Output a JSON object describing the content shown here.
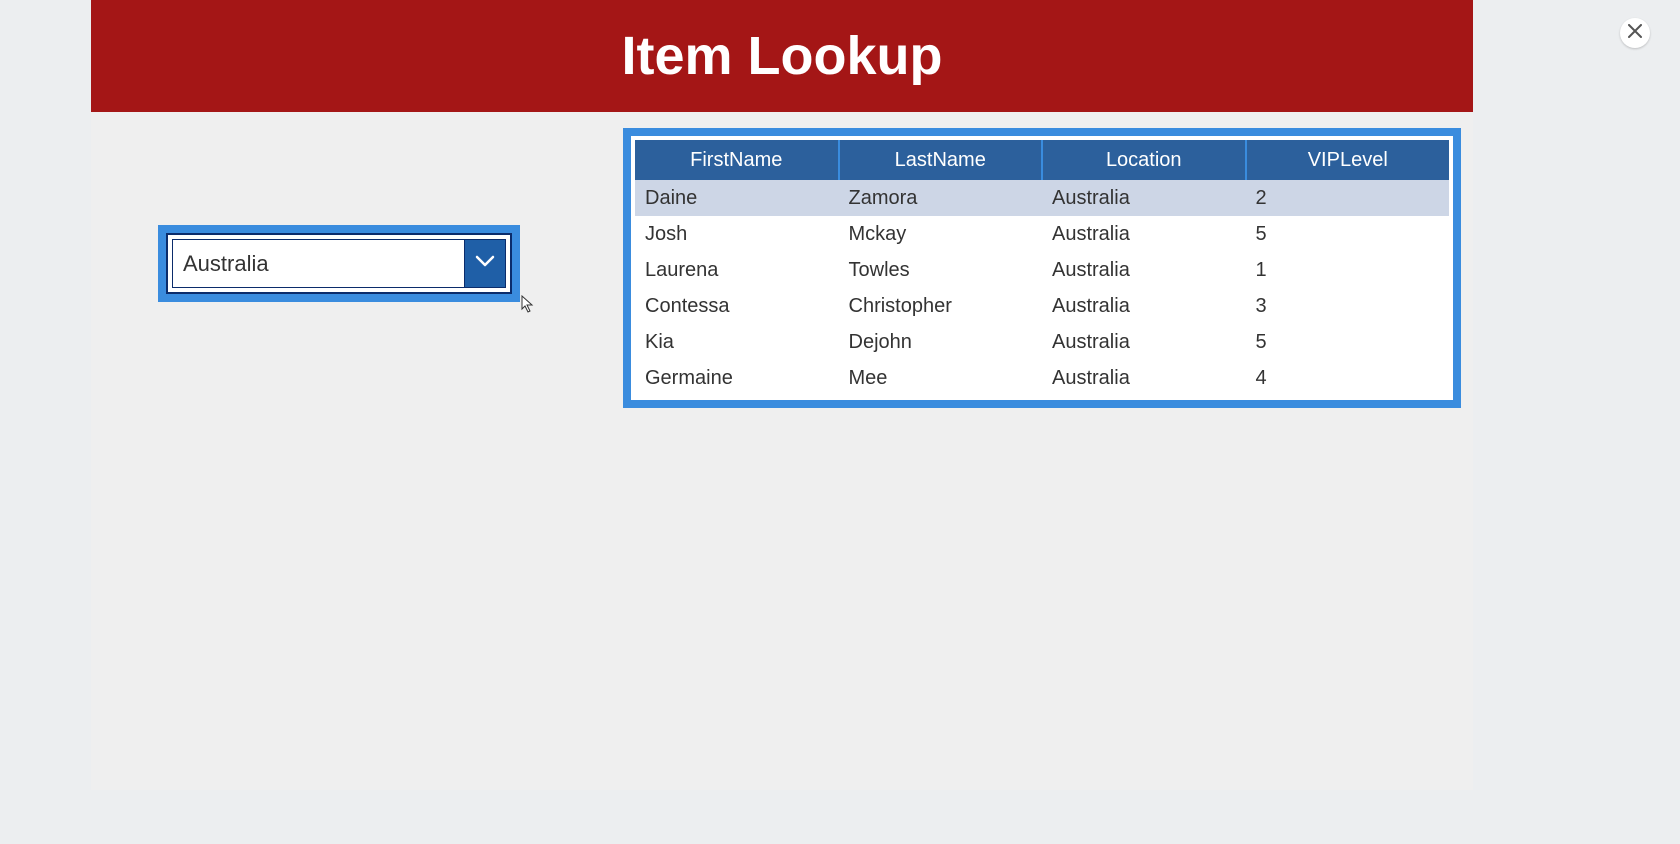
{
  "header": {
    "title": "Item Lookup"
  },
  "filter": {
    "selected": "Australia"
  },
  "table": {
    "columns": [
      "FirstName",
      "LastName",
      "Location",
      "VIPLevel"
    ],
    "rows": [
      {
        "first": "Daine",
        "last": "Zamora",
        "location": "Australia",
        "vip": "2"
      },
      {
        "first": "Josh",
        "last": "Mckay",
        "location": "Australia",
        "vip": "5"
      },
      {
        "first": "Laurena",
        "last": "Towles",
        "location": "Australia",
        "vip": "1"
      },
      {
        "first": "Contessa",
        "last": "Christopher",
        "location": "Australia",
        "vip": "3"
      },
      {
        "first": "Kia",
        "last": "Dejohn",
        "location": "Australia",
        "vip": "5"
      },
      {
        "first": "Germaine",
        "last": "Mee",
        "location": "Australia",
        "vip": "4"
      }
    ]
  }
}
